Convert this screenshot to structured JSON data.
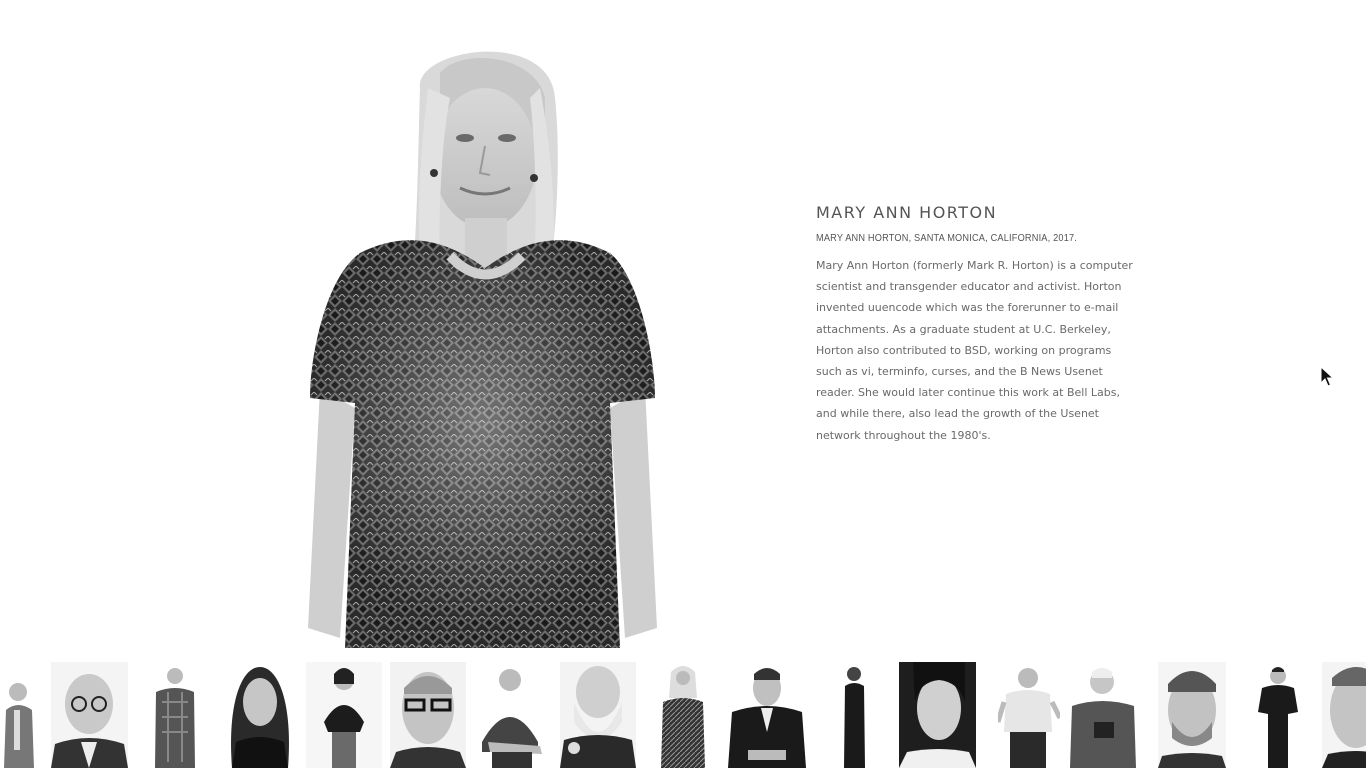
{
  "profile": {
    "name": "MARY ANN HORTON",
    "caption": "MARY ANN HORTON, SANTA MONICA, CALIFORNIA, 2017.",
    "bio": "Mary Ann Horton (formerly Mark R. Horton) is a computer scientist and transgender educator and activist. Horton invented uuencode which was the forerunner to e-mail attachments. As a graduate student at U.C. Berkeley, Horton also contributed to BSD, working on programs such as vi, terminfo, curses, and the B News Usenet reader. She would later continue this work at Bell Labs, and while there, also lead the growth of the Usenet network throughout the 1980's."
  },
  "thumbnails": [
    {
      "id": "t1"
    },
    {
      "id": "t2"
    },
    {
      "id": "t3"
    },
    {
      "id": "t4"
    },
    {
      "id": "t5"
    },
    {
      "id": "t6"
    },
    {
      "id": "t7"
    },
    {
      "id": "t8"
    },
    {
      "id": "t9"
    },
    {
      "id": "t10"
    },
    {
      "id": "t11"
    },
    {
      "id": "t12"
    },
    {
      "id": "t13"
    },
    {
      "id": "t14"
    },
    {
      "id": "t15"
    },
    {
      "id": "t16"
    },
    {
      "id": "t17"
    }
  ],
  "colors": {
    "text_heading": "#555555",
    "text_body": "#6a6a6a",
    "background": "#ffffff"
  }
}
